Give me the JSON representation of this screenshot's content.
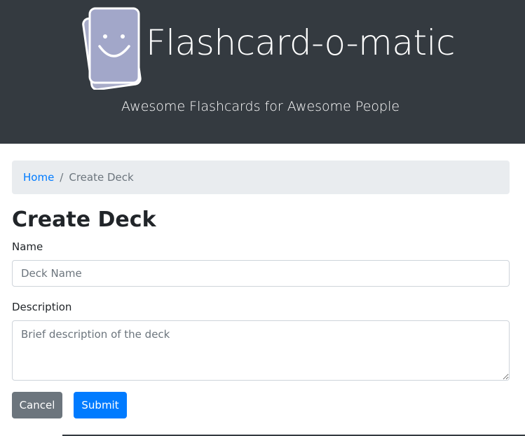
{
  "header": {
    "title": "Flashcard-o-matic",
    "subtitle": "Awesome Flashcards for Awesome People",
    "logo_icon": "smiley-flashcard-icon"
  },
  "breadcrumb": {
    "home": "Home",
    "separator": "/",
    "current": "Create Deck"
  },
  "page": {
    "title": "Create Deck"
  },
  "form": {
    "name_label": "Name",
    "name_placeholder": "Deck Name",
    "name_value": "",
    "description_label": "Description",
    "description_placeholder": "Brief description of the deck",
    "description_value": "",
    "cancel_label": "Cancel",
    "submit_label": "Submit"
  },
  "colors": {
    "header_bg": "#343a40",
    "link": "#007bff",
    "cancel_bg": "#6c757d",
    "submit_bg": "#007bff",
    "breadcrumb_bg": "#e9ecef"
  }
}
